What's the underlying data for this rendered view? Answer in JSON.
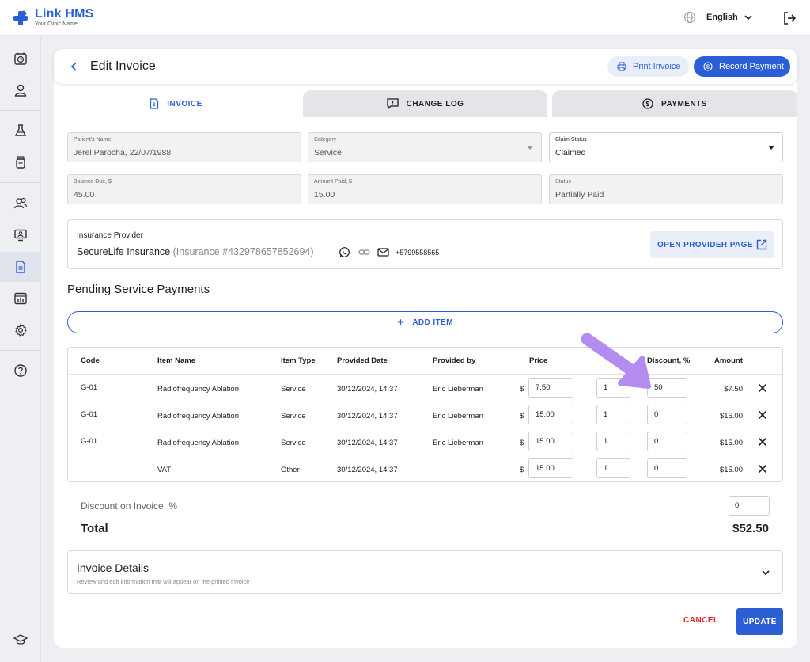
{
  "app": {
    "name": "Link HMS",
    "subtitle": "Your Clinic Name"
  },
  "topbar": {
    "language": "English",
    "globe_icon": "globe-icon",
    "logout_icon": "logout-icon"
  },
  "sidebar": {
    "items": [
      {
        "name": "calendar",
        "icon": "calendar-clock-icon"
      },
      {
        "name": "patients",
        "icon": "user-icon"
      },
      {
        "name": "laboratory",
        "icon": "flask-icon"
      },
      {
        "name": "pharmacy",
        "icon": "medicine-bottle-icon"
      },
      {
        "name": "staff",
        "icon": "users-icon"
      },
      {
        "name": "telemedicine",
        "icon": "monitor-user-icon"
      },
      {
        "name": "invoices",
        "icon": "invoice-icon",
        "active": true
      },
      {
        "name": "reports",
        "icon": "chart-icon"
      },
      {
        "name": "settings",
        "icon": "gear-icon"
      },
      {
        "name": "help",
        "icon": "help-icon"
      },
      {
        "name": "academy",
        "icon": "graduation-cap-icon"
      }
    ]
  },
  "header": {
    "title": "Edit Invoice",
    "print_label": "Print Invoice",
    "record_label": "Record Payment"
  },
  "tabs": [
    {
      "label": "INVOICE",
      "icon": "invoice-icon",
      "active": true
    },
    {
      "label": "CHANGE LOG",
      "icon": "message-alert-icon",
      "active": false
    },
    {
      "label": "PAYMENTS",
      "icon": "dollar-circle-icon",
      "active": false
    }
  ],
  "form": {
    "patient_name": {
      "label": "Patient's Name",
      "value": "Jerel Parocha, 22/07/1988"
    },
    "category": {
      "label": "Category",
      "value": "Service"
    },
    "claim_status": {
      "label": "Claim Status",
      "value": "Claimed"
    },
    "balance_due": {
      "label": "Balance Due, $",
      "value": "45.00"
    },
    "amount_paid": {
      "label": "Amount Paid, $",
      "value": "15.00"
    },
    "status": {
      "label": "Status",
      "value": "Partially Paid"
    }
  },
  "insurance": {
    "label": "Insurance Provider",
    "name": "SecureLife Insurance",
    "number": "(Insurance #432978657852694)",
    "phone": "+5799558565",
    "open_label": "OPEN PROVIDER PAGE"
  },
  "pending": {
    "title": "Pending Service Payments",
    "add_label": "ADD ITEM",
    "columns": [
      "Code",
      "Item Name",
      "Item Type",
      "Provided Date",
      "Provided by",
      "Price",
      "Discount, %",
      "Amount"
    ],
    "currency": "$",
    "rows": [
      {
        "code": "G-01",
        "item": "Radiofrequency Ablation",
        "type": "Service",
        "date": "30/12/2024, 14:37",
        "by": "Eric Lieberman",
        "price": "7.50",
        "qty": "1",
        "discount": "50",
        "amount": "$7.50"
      },
      {
        "code": "G-01",
        "item": "Radiofrequency Ablation",
        "type": "Service",
        "date": "30/12/2024, 14:37",
        "by": "Eric Lieberman",
        "price": "15.00",
        "qty": "1",
        "discount": "0",
        "amount": "$15.00"
      },
      {
        "code": "G-01",
        "item": "Radiofrequency Ablation",
        "type": "Service",
        "date": "30/12/2024, 14:37",
        "by": "Eric Lieberman",
        "price": "15.00",
        "qty": "1",
        "discount": "0",
        "amount": "$15.00"
      },
      {
        "code": "",
        "item": "VAT",
        "type": "Other",
        "date": "30/12/2024, 14:37",
        "by": "",
        "price": "15.00",
        "qty": "1",
        "discount": "0",
        "amount": "$15.00"
      }
    ]
  },
  "summary": {
    "discount_label": "Discount on Invoice, %",
    "discount_value": "0",
    "total_label": "Total",
    "total_value": "$52.50"
  },
  "details": {
    "title": "Invoice Details",
    "subtitle": "Review and edit information that will appear on the printed invoice"
  },
  "actions": {
    "cancel": "CANCEL",
    "update": "UPDATE"
  },
  "colors": {
    "primary": "#2c5fd6",
    "danger": "#e02424",
    "annotation": "#b48cf0"
  }
}
